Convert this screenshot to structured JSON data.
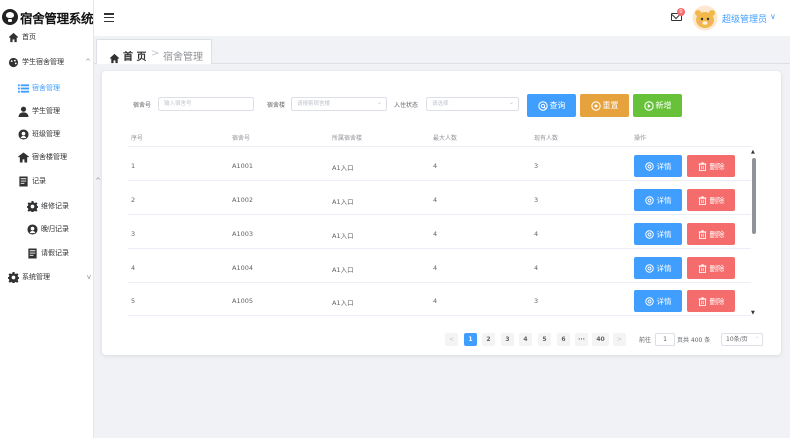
{
  "app": {
    "title": "宿舍管理系统"
  },
  "sidebar": {
    "items": [
      {
        "label": "首页"
      },
      {
        "label": "学生宿舍管理",
        "arrow": "^"
      },
      {
        "label": "宿舍管理"
      },
      {
        "label": "学生管理"
      },
      {
        "label": "班级管理"
      },
      {
        "label": "宿舍楼管理"
      },
      {
        "label": "记录",
        "arrow": "^"
      },
      {
        "label": "维修记录"
      },
      {
        "label": "晚归记录"
      },
      {
        "label": "请假记录"
      },
      {
        "label": "系统管理",
        "arrow": "v"
      }
    ]
  },
  "header": {
    "badge": "0",
    "user_name": "超级管理员",
    "caret": "∨"
  },
  "breadcrumb": {
    "first": "首 页",
    "sep": ">",
    "second": "宿舍管理"
  },
  "filters": {
    "room_label": "宿舍号",
    "room_placeholder": "输入宿舍号",
    "building_label": "宿舍楼",
    "building_placeholder": "请搜索宿舍楼",
    "status_label": "入住状态",
    "status_placeholder": "请选择",
    "caret": "⌄"
  },
  "buttons": {
    "search": "查询",
    "reset": "重置",
    "add": "新增"
  },
  "table": {
    "columns": [
      "序号",
      "宿舍号",
      "所属宿舍楼",
      "最大人数",
      "现有人数",
      "操作"
    ],
    "rows": [
      {
        "index": "1",
        "room": "A1001",
        "building": "A1入口",
        "max": "4",
        "current": "3"
      },
      {
        "index": "2",
        "room": "A1002",
        "building": "A1入口",
        "max": "4",
        "current": "3"
      },
      {
        "index": "3",
        "room": "A1003",
        "building": "A1入口",
        "max": "4",
        "current": "4"
      },
      {
        "index": "4",
        "room": "A1004",
        "building": "A1入口",
        "max": "4",
        "current": "4"
      },
      {
        "index": "5",
        "room": "A1005",
        "building": "A1入口",
        "max": "4",
        "current": "3"
      }
    ],
    "detail_label": "详情",
    "delete_label": "删除"
  },
  "pagination": {
    "prev": "<",
    "next": ">",
    "pages": [
      "1",
      "2",
      "3",
      "4",
      "5",
      "6"
    ],
    "ellipsis": "···",
    "last": "40",
    "goto_label": "前往",
    "goto_value": "1",
    "total": "页共 400 条",
    "page_size": "10条/页"
  },
  "colors": {
    "primary": "#409eff",
    "warning": "#e6a23c",
    "success": "#67c23a",
    "danger": "#f56c6c"
  }
}
